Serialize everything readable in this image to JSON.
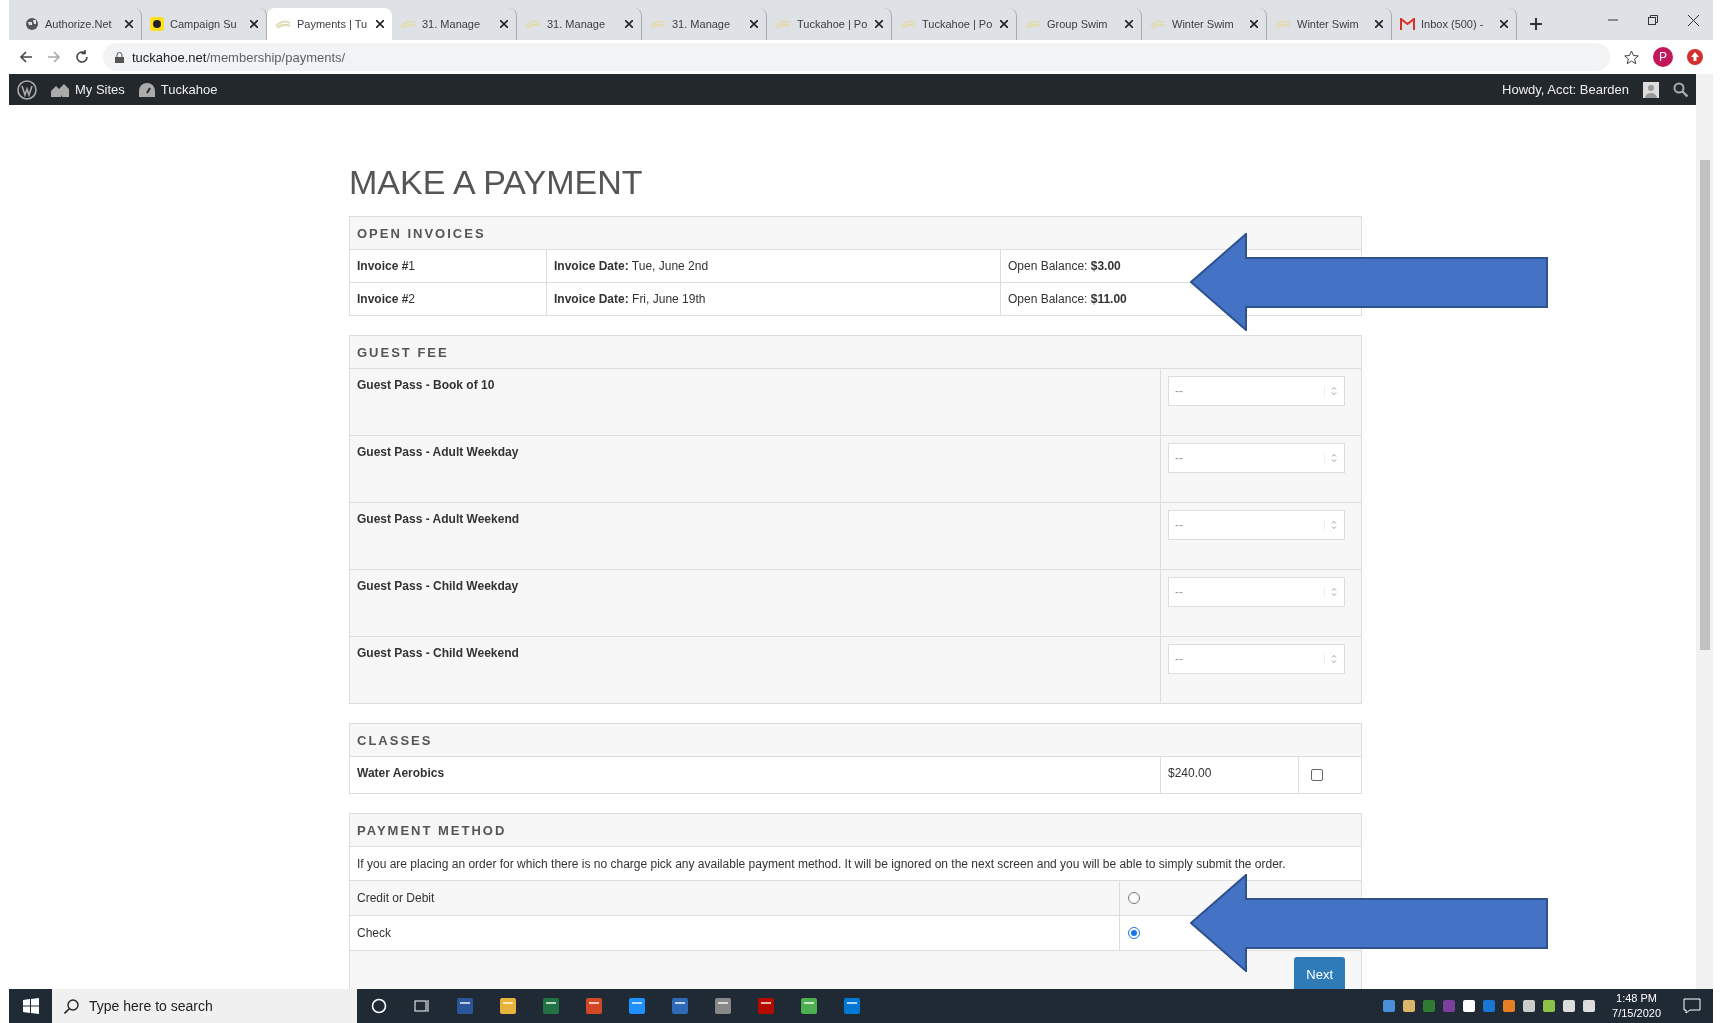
{
  "browser": {
    "tabs": [
      {
        "title": "Authorize.Net",
        "kind": "globe",
        "selected": false
      },
      {
        "title": "Campaign Su",
        "kind": "monkey",
        "selected": false
      },
      {
        "title": "Payments | Tu",
        "kind": "site",
        "selected": true
      },
      {
        "title": "31. Manage",
        "kind": "site",
        "selected": false
      },
      {
        "title": "31. Manage",
        "kind": "site",
        "selected": false
      },
      {
        "title": "31. Manage",
        "kind": "site",
        "selected": false
      },
      {
        "title": "Tuckahoe | Po",
        "kind": "site",
        "selected": false
      },
      {
        "title": "Tuckahoe | Po",
        "kind": "site",
        "selected": false
      },
      {
        "title": "Group Swim",
        "kind": "site",
        "selected": false
      },
      {
        "title": "Winter Swim",
        "kind": "site",
        "selected": false
      },
      {
        "title": "Winter Swim",
        "kind": "site",
        "selected": false
      },
      {
        "title": "Inbox (500) -",
        "kind": "mail",
        "selected": false
      }
    ],
    "url_host": "tuckahoe.net",
    "url_path": "/membership/payments/",
    "profile_initial": "P"
  },
  "admin_bar": {
    "items": [
      "My Sites",
      "Tuckahoe"
    ],
    "greeting": "Howdy, Acct: Bearden"
  },
  "page_title": "MAKE A PAYMENT",
  "open_invoices": {
    "heading": "OPEN INVOICES",
    "rows": [
      {
        "invoice_label": "Invoice #",
        "invoice_number": "1",
        "date_label": "Invoice Date:",
        "date": "Tue, June 2nd",
        "balance_label": "Open Balance:",
        "balance": "$3.00"
      },
      {
        "invoice_label": "Invoice #",
        "invoice_number": "2",
        "date_label": "Invoice Date:",
        "date": "Fri, June 19th",
        "balance_label": "Open Balance:",
        "balance": "$11.00"
      }
    ]
  },
  "guest_fee": {
    "heading": "GUEST FEE",
    "items": [
      {
        "name": "Guest Pass - Book of 10",
        "value": "--"
      },
      {
        "name": "Guest Pass - Adult Weekday",
        "value": "--"
      },
      {
        "name": "Guest Pass - Adult Weekend",
        "value": "--"
      },
      {
        "name": "Guest Pass - Child Weekday",
        "value": "--"
      },
      {
        "name": "Guest Pass - Child Weekend",
        "value": "--"
      }
    ]
  },
  "classes": {
    "heading": "CLASSES",
    "items": [
      {
        "name": "Water Aerobics",
        "price": "$240.00",
        "checked": false
      }
    ]
  },
  "payment_method": {
    "heading": "PAYMENT METHOD",
    "note": "If you are placing an order for which there is no charge pick any available payment method. It will be ignored on the next screen and you will be able to simply submit the order.",
    "options": [
      {
        "label": "Credit or Debit",
        "selected": false
      },
      {
        "label": "Check",
        "selected": true
      }
    ],
    "submit": "Next"
  },
  "taskbar": {
    "search_placeholder": "Type here to search",
    "time": "1:48 PM",
    "date": "7/15/2020"
  }
}
